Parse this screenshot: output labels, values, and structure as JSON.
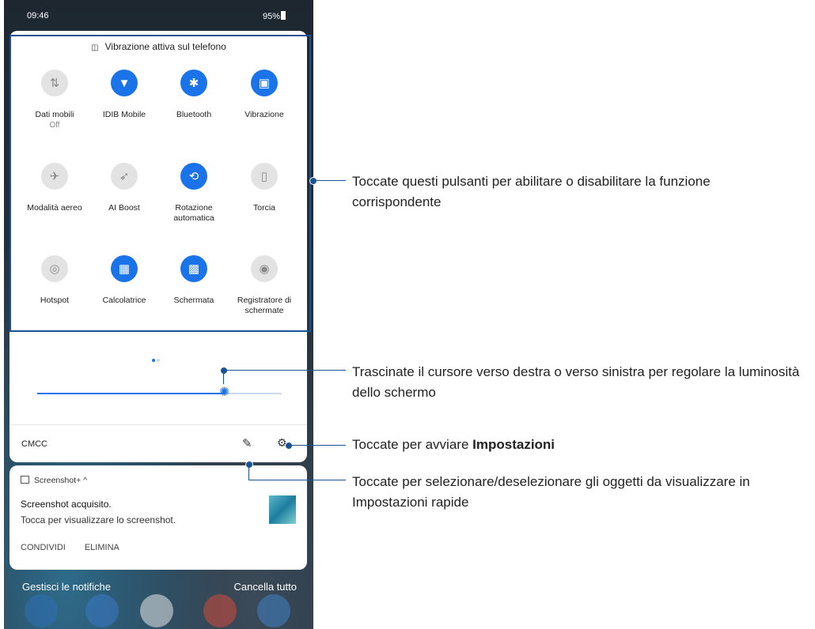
{
  "status_bar": {
    "time": "09:46",
    "battery": "95%"
  },
  "quick_settings": {
    "header": "Vibrazione attiva sul telefono",
    "tiles": [
      {
        "label": "Dati mobili",
        "sublabel": "Off",
        "state": "off",
        "icon": "mobile-data-icon"
      },
      {
        "label": "IDIB Mobile",
        "sublabel": "",
        "state": "on",
        "icon": "wifi-icon"
      },
      {
        "label": "Bluetooth",
        "sublabel": "",
        "state": "on",
        "icon": "bluetooth-icon"
      },
      {
        "label": "Vibrazione",
        "sublabel": "",
        "state": "on",
        "icon": "vibration-icon"
      },
      {
        "label": "Modalità aereo",
        "sublabel": "",
        "state": "off",
        "icon": "airplane-icon"
      },
      {
        "label": "AI Boost",
        "sublabel": "",
        "state": "off",
        "icon": "rocket-icon"
      },
      {
        "label": "Rotazione automatica",
        "sublabel": "",
        "state": "on",
        "icon": "rotate-icon"
      },
      {
        "label": "Torcia",
        "sublabel": "",
        "state": "off",
        "icon": "flashlight-icon"
      },
      {
        "label": "Hotspot",
        "sublabel": "",
        "state": "off",
        "icon": "hotspot-icon"
      },
      {
        "label": "Calcolatrice",
        "sublabel": "",
        "state": "on",
        "icon": "calculator-icon"
      },
      {
        "label": "Schermata",
        "sublabel": "",
        "state": "on",
        "icon": "screenshot-icon"
      },
      {
        "label": "Registratore di schermate",
        "sublabel": "",
        "state": "off",
        "icon": "screen-record-icon"
      }
    ],
    "brightness_level": 0.77,
    "carrier": "CMCC"
  },
  "notification": {
    "app": "Screenshot+ ^",
    "title": "Screenshot acquisito.",
    "body": "Tocca per visualizzare lo screenshot.",
    "actions": [
      "CONDIVIDI",
      "ELIMINA"
    ]
  },
  "footer": {
    "manage": "Gestisci le notifiche",
    "clear_all": "Cancella tutto"
  },
  "callouts": {
    "tiles": "Toccate questi pulsanti per abilitare o disabilitare la funzione corrispondente",
    "brightness": "Trascinate il cursore verso destra o verso sinistra per regolare la luminosità dello schermo",
    "settings_prefix": "Toccate per avviare ",
    "settings_bold": "Impostazioni",
    "edit": "Toccate per selezionare/deselezionare gli oggetti da visualizzare in Impostazioni rapide"
  },
  "colors": {
    "accent": "#1a73e8",
    "callout": "#1a5394",
    "tile_off": "#e3e3e3"
  }
}
